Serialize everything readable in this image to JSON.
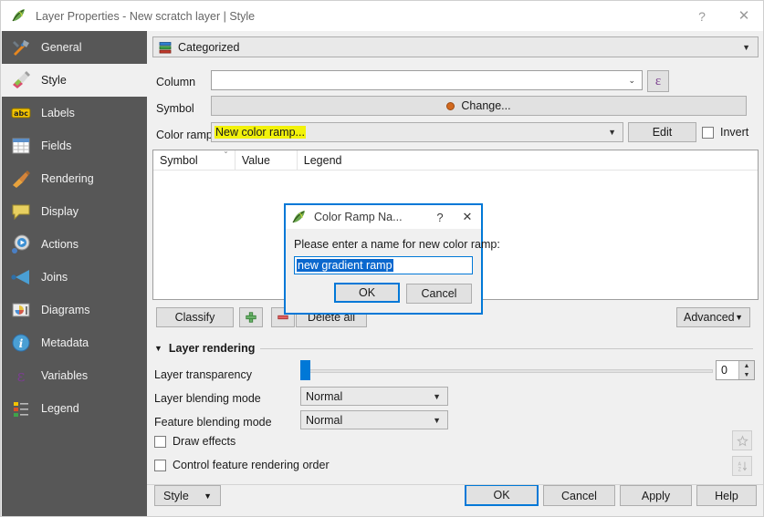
{
  "window": {
    "title": "Layer Properties - New scratch layer | Style",
    "icon": "qgis-leaf-icon",
    "help_button": "?",
    "close_button": "✕"
  },
  "sidebar": {
    "items": [
      {
        "label": "General",
        "icon": "tools-icon",
        "active": false
      },
      {
        "label": "Style",
        "icon": "paintbrush-icon",
        "active": true
      },
      {
        "label": "Labels",
        "icon": "abc-label-icon",
        "active": false
      },
      {
        "label": "Fields",
        "icon": "table-icon",
        "active": false
      },
      {
        "label": "Rendering",
        "icon": "broom-icon",
        "active": false
      },
      {
        "label": "Display",
        "icon": "speech-bubble-icon",
        "active": false
      },
      {
        "label": "Actions",
        "icon": "gear-play-icon",
        "active": false
      },
      {
        "label": "Joins",
        "icon": "join-arrow-icon",
        "active": false
      },
      {
        "label": "Diagrams",
        "icon": "chart-icon",
        "active": false
      },
      {
        "label": "Metadata",
        "icon": "info-icon",
        "active": false
      },
      {
        "label": "Variables",
        "icon": "epsilon-icon",
        "active": false
      },
      {
        "label": "Legend",
        "icon": "legend-icon",
        "active": false
      }
    ]
  },
  "renderer": {
    "value": "Categorized",
    "icon": "categorized-icon",
    "arrow": "▼"
  },
  "form": {
    "column_label": "Column",
    "column_value": "",
    "column_arrow": "⌄",
    "expression_button": "ε",
    "symbol_label": "Symbol",
    "symbol_change_label": "Change...",
    "color_ramp_label": "Color ramp",
    "color_ramp_value": "New color ramp...",
    "color_ramp_arrow": "▼",
    "edit_label": "Edit",
    "invert_label": "Invert"
  },
  "categories_table": {
    "columns": [
      "Symbol",
      "Value",
      "Legend"
    ],
    "rows": [],
    "sort_indicator": "⌄"
  },
  "table_toolbar": {
    "classify_label": "Classify",
    "add_label": "+",
    "remove_label": "–",
    "delete_all_label": "Delete all",
    "advanced_label": "Advanced",
    "advanced_arrow": "▼"
  },
  "layer_rendering": {
    "section_title": "Layer rendering",
    "section_arrow": "▼",
    "transparency_label": "Layer transparency",
    "transparency_value": "0",
    "transparency_percent": 0,
    "layer_blending_label": "Layer blending mode",
    "layer_blending_value": "Normal",
    "feature_blending_label": "Feature blending mode",
    "feature_blending_value": "Normal",
    "draw_effects_label": "Draw effects",
    "draw_effects_checked": false,
    "control_order_label": "Control feature rendering order",
    "control_order_checked": false,
    "effects_icon": "star-icon",
    "sort_icon": "sort-az-icon",
    "combo_arrow": "▼"
  },
  "bottom_bar": {
    "style_label": "Style",
    "style_arrow": "▼",
    "ok_label": "OK",
    "cancel_label": "Cancel",
    "apply_label": "Apply",
    "help_label": "Help"
  },
  "modal": {
    "title": "Color Ramp Na...",
    "icon": "qgis-leaf-icon",
    "help_button": "?",
    "close_button": "✕",
    "prompt": "Please enter a name for new color ramp:",
    "input_value": "new gradient ramp",
    "ok_label": "OK",
    "cancel_label": "Cancel"
  },
  "colors": {
    "accent": "#0078d7",
    "sidebar_bg": "#575757",
    "panel_bg": "#f0f0f0",
    "highlight_yellow": "#f2f20a",
    "selection_blue": "#0b68ce",
    "marker_orange": "#d2691e"
  }
}
